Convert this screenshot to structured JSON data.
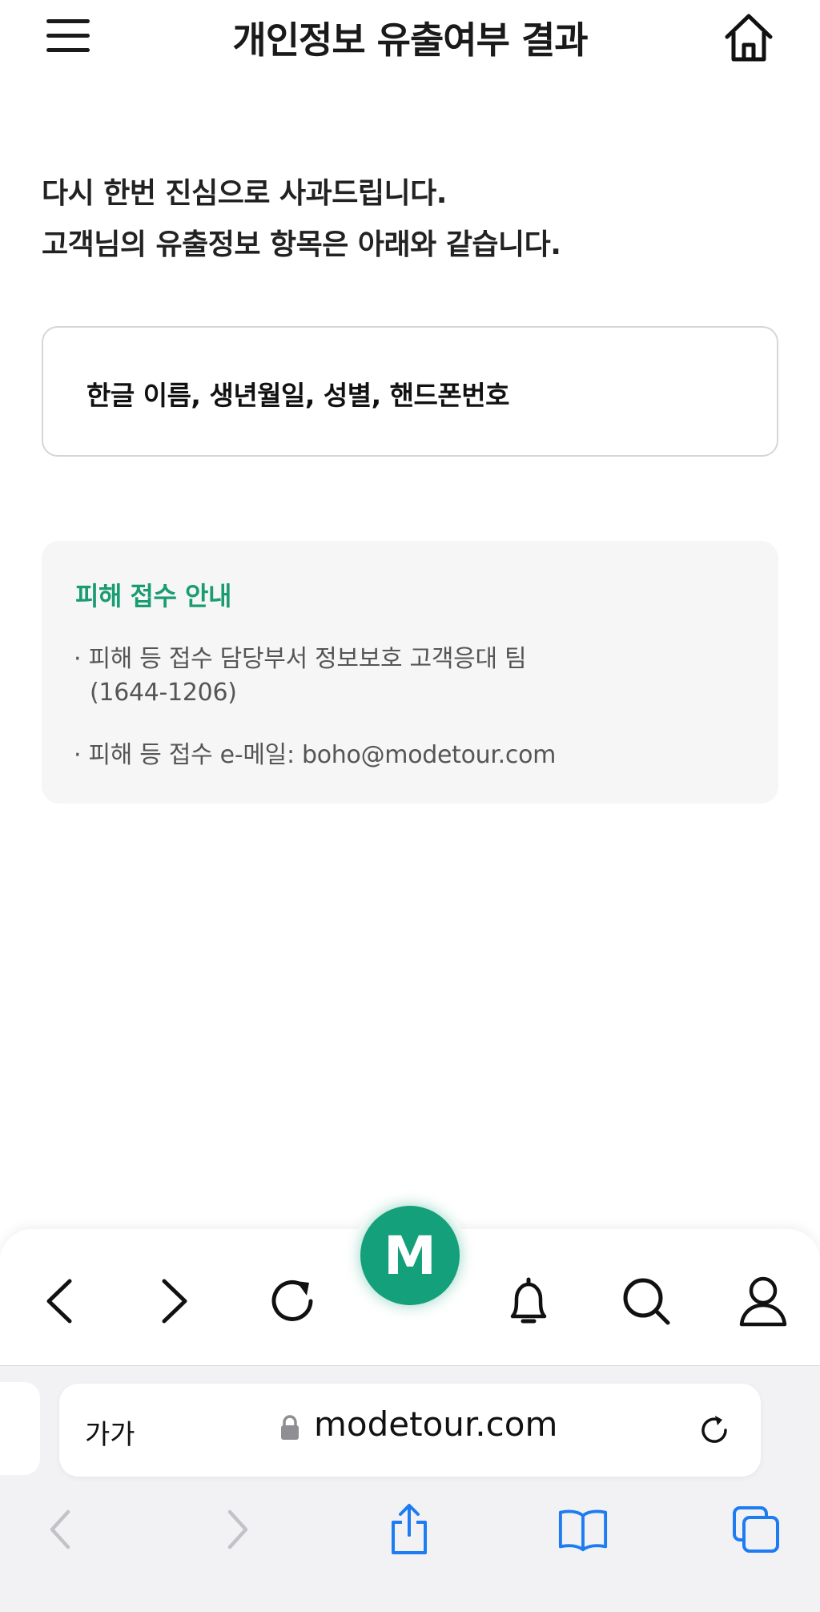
{
  "header": {
    "title": "개인정보 유출여부 결과",
    "menu_icon": "hamburger-menu-icon",
    "home_icon": "home-icon"
  },
  "intro": {
    "line1": "다시 한번 진심으로 사과드립니다.",
    "line2": "고객님의 유출정보 항목은 아래와 같습니다."
  },
  "leaked_info": {
    "items": "한글 이름, 생년월일, 성별, 핸드폰번호"
  },
  "notice": {
    "title": "피해 접수 안내",
    "line1": "· 피해 등 접수 담당부서 정보보호 고객응대 팀",
    "line2": "(1644-1206)",
    "line3": "· 피해 등 접수 e-메일: boho@modetour.com"
  },
  "app_nav": {
    "items": [
      "back-icon",
      "forward-icon",
      "refresh-icon",
      "bell-icon",
      "search-icon",
      "user-icon"
    ],
    "center_label": "M"
  },
  "browser": {
    "text_size_label": "가가",
    "url": "modetour.com",
    "toolbar": [
      "back-icon",
      "forward-icon",
      "share-icon",
      "bookmarks-icon",
      "tabs-icon"
    ]
  },
  "colors": {
    "accent": "#1a9c72",
    "brand_green": "#14a07a",
    "safari_blue": "#1e7cf2"
  }
}
